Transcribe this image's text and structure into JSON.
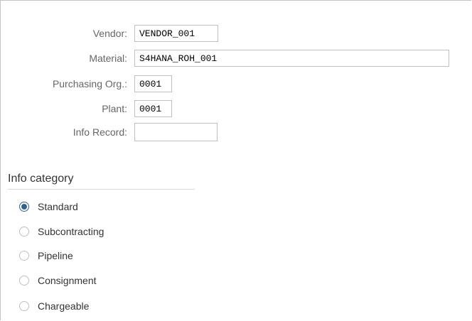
{
  "fields": [
    {
      "label": "Vendor:",
      "value": "VENDOR_001"
    },
    {
      "label": "Material:",
      "value": "S4HANA_ROH_001"
    },
    {
      "label": "Purchasing Org.:",
      "value": "0001"
    },
    {
      "label": "Plant:",
      "value": "0001"
    },
    {
      "label": "Info Record:",
      "value": ""
    }
  ],
  "info_category": {
    "title": "Info category",
    "selected": "Standard",
    "options": [
      "Standard",
      "Subcontracting",
      "Pipeline",
      "Consignment",
      "Chargeable"
    ]
  },
  "colors": {
    "accent": "#346187",
    "border": "#bfbfbf",
    "label": "#666666"
  }
}
